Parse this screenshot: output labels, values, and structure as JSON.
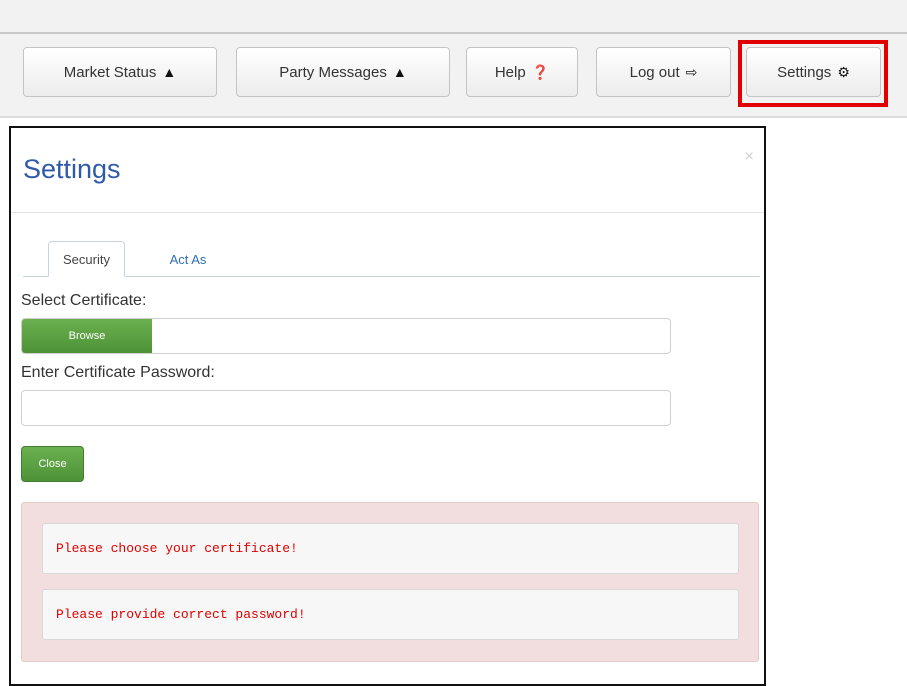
{
  "nav": {
    "market_status": {
      "label": "Market Status",
      "icon": "▲"
    },
    "party_messages": {
      "label": "Party Messages",
      "icon": "▲"
    },
    "help": {
      "label": "Help",
      "icon": "❓"
    },
    "logout": {
      "label": "Log out",
      "icon": "⇨"
    },
    "settings": {
      "label": "Settings",
      "icon": "⚙"
    },
    "highlight_color": "#e00000"
  },
  "modal": {
    "title": "Settings",
    "close_icon": "×",
    "tabs": [
      {
        "label": "Security",
        "active": true
      },
      {
        "label": "Act As",
        "active": false
      }
    ],
    "select_certificate_label": "Select Certificate:",
    "browse_label": "Browse",
    "password_label": "Enter Certificate Password:",
    "password_value": "",
    "close_label": "Close",
    "errors": [
      "Please choose your certificate!",
      "Please provide correct password!"
    ],
    "colors": {
      "title": "#2f5aa8",
      "button_green": "#5ca043",
      "error_bg": "#f2dede",
      "error_text": "#e00000"
    }
  }
}
